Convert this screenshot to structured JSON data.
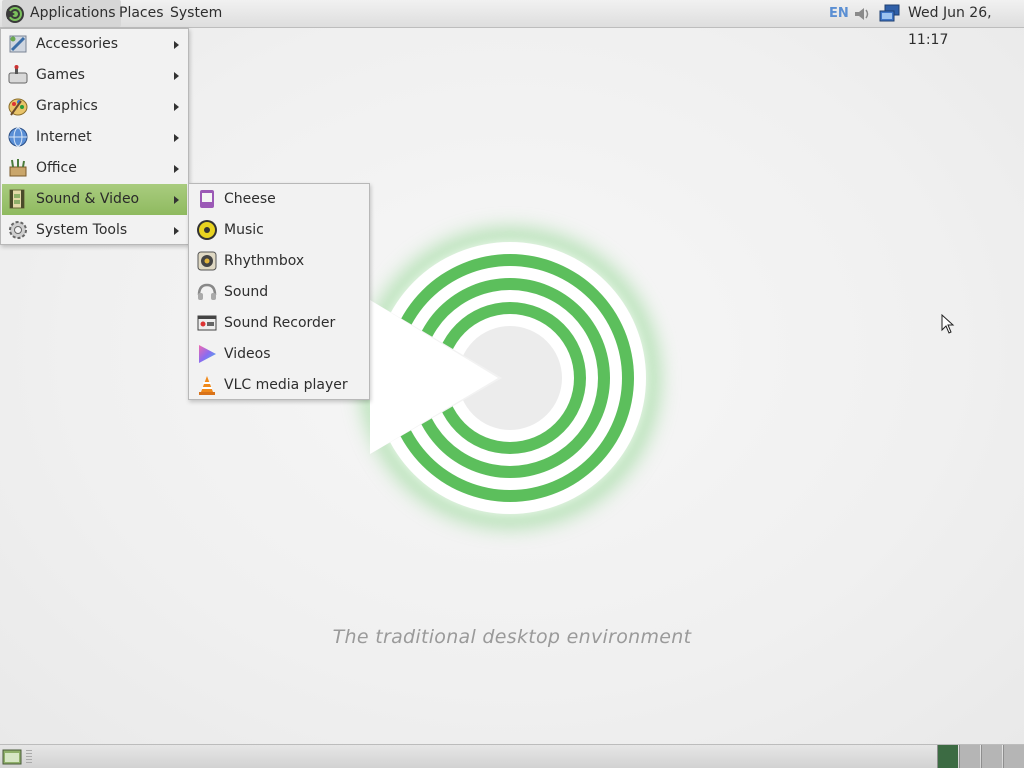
{
  "top_panel": {
    "menus": {
      "applications": "Applications",
      "places": "Places",
      "system": "System"
    },
    "keyboard_layout": "EN",
    "clock": "Wed Jun 26, 11:17"
  },
  "applications_menu": {
    "items": [
      {
        "label": "Accessories",
        "icon": "accessories-icon",
        "has_submenu": true
      },
      {
        "label": "Games",
        "icon": "games-icon",
        "has_submenu": true
      },
      {
        "label": "Graphics",
        "icon": "graphics-icon",
        "has_submenu": true
      },
      {
        "label": "Internet",
        "icon": "internet-icon",
        "has_submenu": true
      },
      {
        "label": "Office",
        "icon": "office-icon",
        "has_submenu": true
      },
      {
        "label": "Sound & Video",
        "icon": "sound-video-icon",
        "has_submenu": true,
        "active": true
      },
      {
        "label": "System Tools",
        "icon": "system-tools-icon",
        "has_submenu": true
      }
    ]
  },
  "sound_video_submenu": {
    "items": [
      {
        "label": "Cheese",
        "icon": "cheese-icon"
      },
      {
        "label": "Music",
        "icon": "music-icon"
      },
      {
        "label": "Rhythmbox",
        "icon": "rhythmbox-icon"
      },
      {
        "label": "Sound",
        "icon": "sound-icon"
      },
      {
        "label": "Sound Recorder",
        "icon": "sound-recorder-icon"
      },
      {
        "label": "Videos",
        "icon": "videos-icon"
      },
      {
        "label": "VLC media player",
        "icon": "vlc-icon"
      }
    ]
  },
  "desktop": {
    "tagline": "The traditional desktop environment"
  },
  "bottom_panel": {
    "workspaces": 4,
    "current_workspace": 1
  },
  "colors": {
    "accent_green": "#8fba5f",
    "logo_green": "#5cbf5c"
  }
}
